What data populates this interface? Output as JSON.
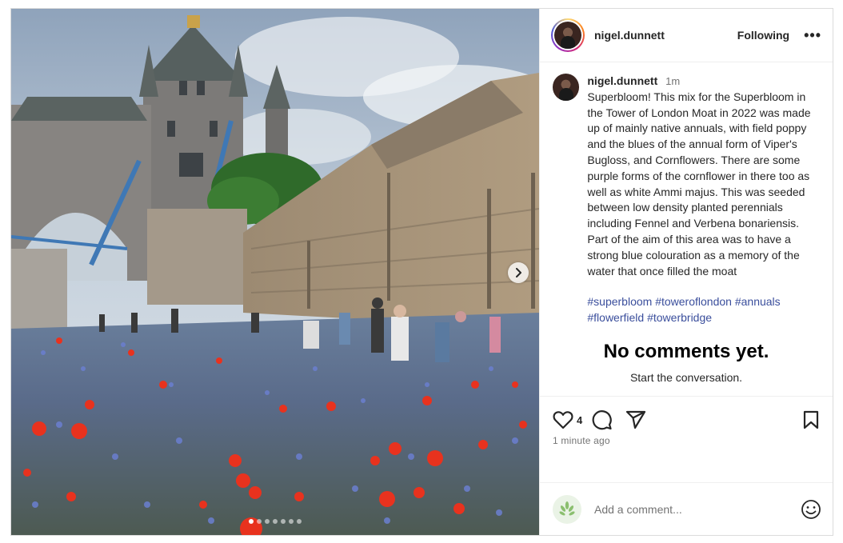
{
  "post": {
    "username": "nigel.dunnett",
    "follow_status": "Following",
    "more_label": "•••",
    "caption": {
      "time": "1m",
      "text": "Superbloom!  This mix for the Superbloom in the Tower of London Moat in 2022 was made up of mainly native annuals, with field poppy and the blues of the annual form of Viper's Bugloss, and Cornflowers. There are some purple forms of the cornflower in there too as well as white Ammi majus. This was seeded between low density planted perennials including Fennel and Verbena bonariensis. Part of the aim of this area was to have a strong blue colouration as a memory of the water that once filled the moat",
      "hashtags": [
        "#superbloom",
        "#toweroflondon",
        "#annuals",
        "#flowerfield",
        "#towerbridge"
      ]
    },
    "empty_comments": {
      "title": "No comments yet.",
      "subtitle": "Start the conversation."
    },
    "likes": "4",
    "posted_ago": "1 minute ago",
    "comment_placeholder": "Add a comment...",
    "carousel": {
      "slide_count": 7,
      "active_index": 0
    },
    "icons": {
      "like": "heart-icon",
      "comment": "comment-icon",
      "share": "share-icon",
      "save": "bookmark-icon",
      "emoji": "emoji-icon",
      "next": "chevron-right-icon"
    },
    "colors": {
      "hashtag": "#3a4e9c",
      "muted": "#737373",
      "text": "#262626"
    }
  }
}
